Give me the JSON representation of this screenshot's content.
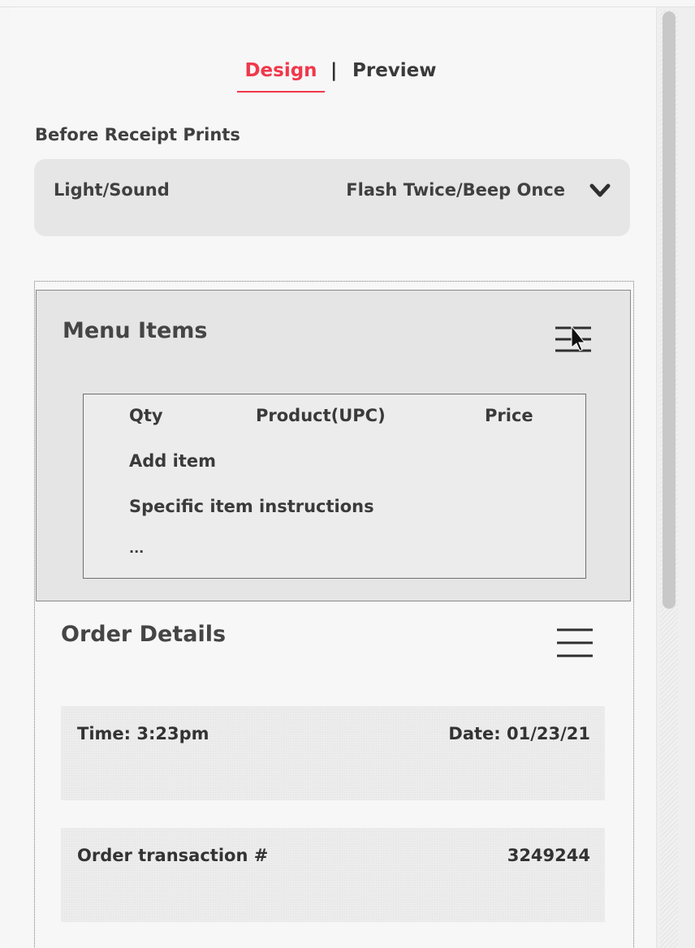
{
  "tabs": {
    "design": "Design",
    "separator": "|",
    "preview": "Preview",
    "active": "Design",
    "accent_color": "#f0384c"
  },
  "before_receipt": {
    "heading": "Before Receipt Prints",
    "dropdown_label": "Light/Sound",
    "dropdown_value": "Flash Twice/Beep Once",
    "chevron_icon": "chevron-down-icon"
  },
  "menu_items": {
    "title": "Menu Items",
    "options_icon": "menu-adjust-icon",
    "columns": [
      "Qty",
      "Product(UPC)",
      "Price"
    ],
    "rows": [
      "Add item",
      "Specific item instructions",
      "..."
    ]
  },
  "order_details": {
    "title": "Order Details",
    "menu_icon": "hamburger-icon",
    "time_label": "Time: 3:23pm",
    "date_label": "Date: 01/23/21",
    "transaction_label": "Order transaction #",
    "transaction_value": "3249244"
  }
}
